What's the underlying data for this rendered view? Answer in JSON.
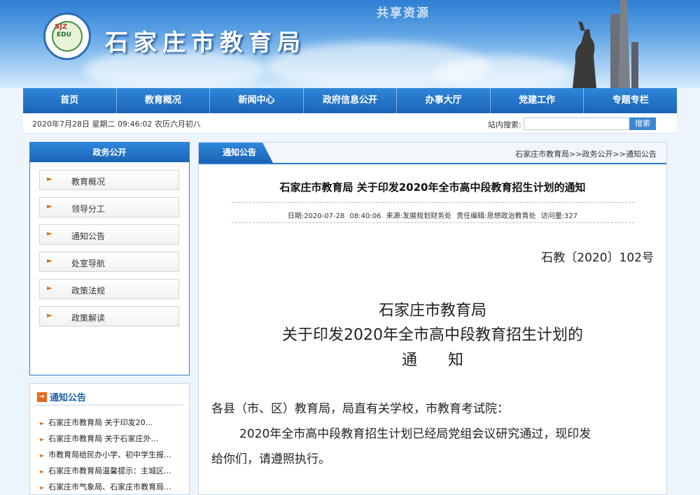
{
  "header": {
    "watermark": "共享资源",
    "site_title": "石家庄市教育局",
    "logo_mark": "SJZ",
    "logo_mark2": "EDU"
  },
  "nav": [
    "首页",
    "教育概况",
    "新闻中心",
    "政府信息公开",
    "办事大厅",
    "党建工作",
    "专题专栏"
  ],
  "infobar": {
    "date_text": "2020年7月28日 星期二 09:46:02 农历六月初八",
    "search_label": "站内搜索:",
    "search_value": "",
    "search_button": "搜索"
  },
  "sidebar": {
    "title": "政务公开",
    "items": [
      "教育概况",
      "领导分工",
      "通知公告",
      "处室导航",
      "政策法规",
      "政策解读"
    ]
  },
  "notice": {
    "title": "通知公告",
    "items": [
      "石家庄市教育局 关于印发20...",
      "石家庄市教育局 关于石家庄外...",
      "市教育局给民办小学、初中学生报...",
      "石家庄市教育局温馨提示：主城区...",
      "石家庄市气象局、石家庄市教育局..."
    ]
  },
  "main": {
    "tab": "通知公告",
    "breadcrumb": "石家庄市教育局>>政务公开>>通知公告",
    "article_title": "石家庄市教育局 关于印发2020年全市高中段教育招生计划的通知",
    "meta": "日期:2020-07-28 08:40:06  来源:发展规划财务处  责任编辑:思想政治教育处  访问量:327",
    "doc_no": "石教〔2020〕102号",
    "doc_title": [
      "石家庄市教育局",
      "关于印发2020年全市高中段教育招生计划的",
      "通　　知"
    ],
    "salutation": "各县（市、区）教育局，局直有关学校，市教育考试院：",
    "body_line1": "2020年全市高中段教育招生计划已经局党组会议研究通过，现印发",
    "body_line2": "给你们，请遵照执行。"
  },
  "colors": {
    "nav_blue": "#1c62b4",
    "accent_orange": "#e06a0c",
    "link_blue": "#1c5fae"
  }
}
